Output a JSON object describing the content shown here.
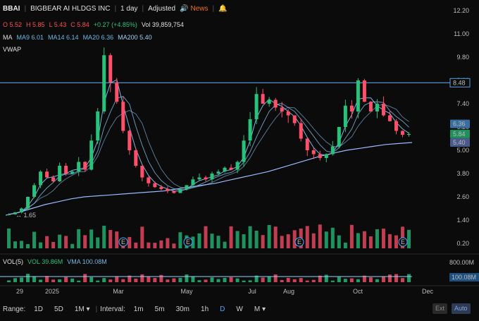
{
  "header": {
    "symbol": "BBAI",
    "company": "BIGBEAR AI HLDGS INC",
    "timeframe": "1 day",
    "adjusted": "Adjusted",
    "news": "News",
    "news_color": "#f36c21"
  },
  "quote": {
    "open": "O 5.52",
    "high": "H 5.85",
    "low": "L 5.43",
    "close": "C 5.84",
    "change": "+0.27 (+4.85%)",
    "volume": "Vol 39,859,754"
  },
  "moving_averages": {
    "label": "MA",
    "ma9": "MA9 6.01",
    "ma14": "MA14 6.14",
    "ma20": "MA20 6.36",
    "ma200": "MA200 5.40"
  },
  "vwap": {
    "label": "VWAP"
  },
  "volume_panel": {
    "label": "VOL(5)",
    "vol": "VOL 39.86M",
    "vma": "VMA 100.08M",
    "axis_top": "800.00M",
    "badge": "100.08M"
  },
  "price_axis": [
    "12.20",
    "11.00",
    "9.80",
    "8.60",
    "7.40",
    "6.20",
    "5.00",
    "3.80",
    "2.60",
    "1.40",
    "0.20"
  ],
  "price_badges": {
    "hline": "8.48",
    "ma20": "6.36",
    "close": "5.84",
    "ma200": "5.40"
  },
  "low_marker": "1.65",
  "time_axis": [
    "29",
    "2025",
    "Mar",
    "May",
    "Jul",
    "Aug",
    "Oct",
    "Dec"
  ],
  "earnings_marker": "E",
  "bottombar": {
    "range_label": "Range:",
    "ranges": [
      "1D",
      "5D",
      "1M"
    ],
    "interval_label": "Interval:",
    "intervals": [
      "1m",
      "5m",
      "30m",
      "1h",
      "D",
      "W",
      "M"
    ],
    "active_interval": "D",
    "ext": "Ext",
    "auto": "Auto"
  },
  "colors": {
    "up": "#27c27c",
    "down": "#ff4f6a",
    "ma_line": "#8fd0ff",
    "ma200_line": "#9cb8ff",
    "hline": "#5aa0e0",
    "accent": "#4aa8ff"
  },
  "chart_data": {
    "type": "line",
    "title": "BBAI",
    "series": [
      {
        "name": "Close",
        "values": [
          1.7,
          1.8,
          2.0,
          2.6,
          3.2,
          3.9,
          3.6,
          3.4,
          4.2,
          3.8,
          3.9,
          4.4,
          4.0,
          5.5,
          7.0,
          9.9,
          8.5,
          7.5,
          6.0,
          5.0,
          4.2,
          3.6,
          3.3,
          3.1,
          3.0,
          2.9,
          2.8,
          3.0,
          3.2,
          3.5,
          3.6,
          3.5,
          3.8,
          3.9,
          4.1,
          4.0,
          4.4,
          5.5,
          6.6,
          7.9,
          7.4,
          7.6,
          7.2,
          7.0,
          6.8,
          6.4,
          5.6,
          5.0,
          4.8,
          4.6,
          4.8,
          5.2,
          6.2,
          7.3,
          7.0,
          8.6,
          7.5,
          7.0,
          7.4,
          6.8,
          6.5,
          6.0,
          5.8,
          5.84
        ]
      },
      {
        "name": "MA200",
        "values": [
          1.65,
          1.8,
          2.0,
          2.2,
          2.35,
          2.5,
          2.6,
          2.65,
          2.7,
          2.75,
          2.8,
          2.85,
          2.9,
          3.0,
          3.1,
          3.2,
          3.3,
          3.45,
          3.6,
          3.75,
          3.9,
          4.1,
          4.3,
          4.5,
          4.7,
          4.85,
          5.0,
          5.1,
          5.2,
          5.3,
          5.35,
          5.4
        ]
      }
    ],
    "ylim": [
      0.2,
      12.2
    ],
    "yticks": [
      12.2,
      11.0,
      9.8,
      8.6,
      7.4,
      6.2,
      5.0,
      3.8,
      2.6,
      1.4,
      0.2
    ],
    "xlabel": "",
    "ylabel": "",
    "grid": false,
    "hline": 8.48
  }
}
